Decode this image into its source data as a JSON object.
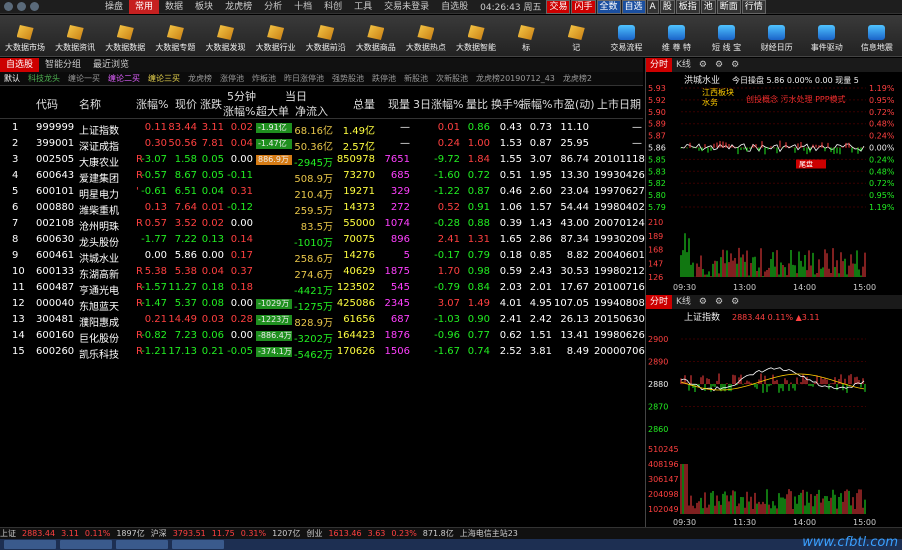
{
  "menubar": {
    "items": [
      "操盘",
      "常用",
      "数据",
      "板块",
      "龙虎榜",
      "分析",
      "十档",
      "科创",
      "工具",
      "交易未登录",
      "自选股"
    ],
    "active_index": 1,
    "clock": "04:26:43 周五",
    "buttons": [
      "交易",
      "闪手",
      "全数",
      "自选",
      "A",
      "股",
      "板指",
      "池",
      "断面",
      "行情"
    ]
  },
  "toolbar": {
    "items": [
      "大数据市场",
      "大数据资讯",
      "大数据数据",
      "大数据专题",
      "大数据发现",
      "大数据行业",
      "大数据前沿",
      "大数据商品",
      "大数据热点",
      "大数据智能",
      "标",
      "记",
      "交易流程",
      "维 尊 特",
      "短 线 宝",
      "财经日历",
      "事件驱动",
      "信息地震"
    ]
  },
  "tabs1": [
    "自选股",
    "智能分组",
    "最近浏览"
  ],
  "tabs2": [
    "默认",
    "科技龙头",
    "缠论一买",
    "缠论二买",
    "缠论三买",
    "龙虎榜",
    "涨停池",
    "炸板池",
    "昨日涨停池",
    "强势股池",
    "跌停池",
    "新股池",
    "次新股池",
    "龙虎榜20190712_43",
    "龙虎榜2"
  ],
  "table": {
    "headers": [
      "代码",
      "名称",
      "涨幅%",
      "现价",
      "涨跌",
      "5分钟",
      "涨幅%",
      "超大单",
      "当日",
      "净流入",
      "总量",
      "现量",
      "3日涨幅%",
      "量比",
      "换手%",
      "振幅%",
      "市盈(动)",
      "上市日期"
    ],
    "rows": [
      {
        "idx": "1",
        "code": "999999",
        "name": "上证指数",
        "chg": "0.11",
        "price": "83.44",
        "diff": "3.11",
        "m5": "0.02",
        "big": "-1.91亿",
        "net": "68.16亿",
        "vol": "1.49亿",
        "cur": "—",
        "d3": "0.01",
        "lb": "0.86",
        "hs": "0.43",
        "zf": "0.73",
        "pe": "11.10",
        "date": "—",
        "up": "r",
        "flag": ""
      },
      {
        "idx": "2",
        "code": "399001",
        "name": "深证成指",
        "chg": "0.30",
        "price": "50.56",
        "diff": "7.81",
        "m5": "0.04",
        "big": "-1.47亿",
        "net": "50.36亿",
        "vol": "2.57亿",
        "cur": "—",
        "d3": "0.24",
        "lb": "1.00",
        "hs": "1.53",
        "zf": "0.87",
        "pe": "25.95",
        "date": "—",
        "up": "r",
        "flag": ""
      },
      {
        "idx": "3",
        "code": "002505",
        "name": "大康农业",
        "chg": "-3.07",
        "price": "1.58",
        "diff": "0.05",
        "m5": "0.00",
        "big": "886.9万",
        "net": "-2945万",
        "vol": "850978",
        "cur": "7651",
        "d3": "-9.72",
        "lb": "1.84",
        "hs": "1.55",
        "zf": "3.07",
        "pe": "86.74",
        "date": "20101118",
        "up": "g",
        "flag": "R"
      },
      {
        "idx": "4",
        "code": "600643",
        "name": "爱建集团",
        "chg": "-0.57",
        "price": "8.67",
        "diff": "0.05",
        "m5": "-0.11",
        "big": "",
        "net": "508.9万",
        "vol": "73270",
        "cur": "685",
        "d3": "-1.60",
        "lb": "0.72",
        "hs": "0.51",
        "zf": "1.95",
        "pe": "13.30",
        "date": "19930426",
        "up": "g",
        "flag": "R"
      },
      {
        "idx": "5",
        "code": "600101",
        "name": "明星电力",
        "chg": "-0.61",
        "price": "6.51",
        "diff": "0.04",
        "m5": "0.31",
        "big": "",
        "net": "210.4万",
        "vol": "19271",
        "cur": "329",
        "d3": "-1.22",
        "lb": "0.87",
        "hs": "0.46",
        "zf": "2.60",
        "pe": "23.04",
        "date": "19970627",
        "up": "g",
        "flag": "'"
      },
      {
        "idx": "6",
        "code": "000880",
        "name": "潍柴重机",
        "chg": "0.13",
        "price": "7.64",
        "diff": "0.01",
        "m5": "-0.12",
        "big": "",
        "net": "259.5万",
        "vol": "14373",
        "cur": "272",
        "d3": "0.52",
        "lb": "0.91",
        "hs": "1.06",
        "zf": "1.57",
        "pe": "54.44",
        "date": "19980402",
        "up": "r",
        "flag": ""
      },
      {
        "idx": "7",
        "code": "002108",
        "name": "沧州明珠",
        "chg": "0.57",
        "price": "3.52",
        "diff": "0.02",
        "m5": "0.00",
        "big": "",
        "net": "83.5万",
        "vol": "55000",
        "cur": "1074",
        "d3": "-0.28",
        "lb": "0.88",
        "hs": "0.39",
        "zf": "1.43",
        "pe": "43.00",
        "date": "20070124",
        "up": "r",
        "flag": "R"
      },
      {
        "idx": "8",
        "code": "600630",
        "name": "龙头股份",
        "chg": "-1.77",
        "price": "7.22",
        "diff": "0.13",
        "m5": "0.14",
        "big": "",
        "net": "-1010万",
        "vol": "70075",
        "cur": "896",
        "d3": "2.41",
        "lb": "1.31",
        "hs": "1.65",
        "zf": "2.86",
        "pe": "87.34",
        "date": "19930209",
        "up": "g",
        "flag": ""
      },
      {
        "idx": "9",
        "code": "600461",
        "name": "洪城水业",
        "chg": "0.00",
        "price": "5.86",
        "diff": "0.00",
        "m5": "0.17",
        "big": "",
        "net": "258.6万",
        "vol": "14276",
        "cur": "5",
        "d3": "-0.17",
        "lb": "0.79",
        "hs": "0.18",
        "zf": "0.85",
        "pe": "8.82",
        "date": "20040601",
        "up": "w",
        "flag": ""
      },
      {
        "idx": "10",
        "code": "600133",
        "name": "东湖高新",
        "chg": "5.38",
        "price": "5.38",
        "diff": "0.04",
        "m5": "0.37",
        "big": "",
        "net": "274.6万",
        "vol": "40629",
        "cur": "1875",
        "d3": "1.70",
        "lb": "0.98",
        "hs": "0.59",
        "zf": "2.43",
        "pe": "30.53",
        "date": "19980212",
        "up": "r",
        "flag": "R"
      },
      {
        "idx": "11",
        "code": "600487",
        "name": "亨通光电",
        "chg": "-1.57",
        "price": "11.27",
        "diff": "0.18",
        "m5": "0.18",
        "big": "",
        "net": "-4421万",
        "vol": "123502",
        "cur": "545",
        "d3": "-0.79",
        "lb": "0.84",
        "hs": "2.03",
        "zf": "2.01",
        "pe": "17.67",
        "date": "20100716",
        "up": "g",
        "flag": "R"
      },
      {
        "idx": "12",
        "code": "000040",
        "name": "东旭蓝天",
        "chg": "-1.47",
        "price": "5.37",
        "diff": "0.08",
        "m5": "0.00",
        "big": "-1029万",
        "net": "-1275万",
        "vol": "425086",
        "cur": "2345",
        "d3": "3.07",
        "lb": "1.49",
        "hs": "4.01",
        "zf": "4.95",
        "pe": "107.05",
        "date": "19940808",
        "up": "g",
        "flag": "R"
      },
      {
        "idx": "13",
        "code": "300481",
        "name": "濮阳惠成",
        "chg": "0.21",
        "price": "14.49",
        "diff": "0.03",
        "m5": "0.28",
        "big": "-1223万",
        "net": "828.9万",
        "vol": "61656",
        "cur": "687",
        "d3": "-1.03",
        "lb": "0.90",
        "hs": "2.41",
        "zf": "2.42",
        "pe": "26.13",
        "date": "20150630",
        "up": "r",
        "flag": ""
      },
      {
        "idx": "14",
        "code": "600160",
        "name": "巨化股份",
        "chg": "-0.82",
        "price": "7.23",
        "diff": "0.06",
        "m5": "0.00",
        "big": "-886.4万",
        "net": "-3202万",
        "vol": "164423",
        "cur": "1876",
        "d3": "-0.96",
        "lb": "0.77",
        "hs": "0.62",
        "zf": "1.51",
        "pe": "13.41",
        "date": "19980626",
        "up": "g",
        "flag": "R"
      },
      {
        "idx": "15",
        "code": "600260",
        "name": "凯乐科技",
        "chg": "-1.21",
        "price": "17.13",
        "diff": "0.21",
        "m5": "-0.05",
        "big": "-374.1万",
        "net": "-5462万",
        "vol": "170626",
        "cur": "1506",
        "d3": "-1.67",
        "lb": "0.74",
        "hs": "2.52",
        "zf": "3.81",
        "pe": "8.49",
        "date": "20000706",
        "up": "g",
        "flag": "R"
      }
    ]
  },
  "panel_top": {
    "tabs": [
      "分时",
      "K线"
    ],
    "stock": "洪城水业",
    "quote": "今日操盘 5.86 0.00% 0.00 现量 5",
    "label1": "江西板块",
    "label2": "水务",
    "concepts": "创投概念 污水处理 PPP模式",
    "y_right": [
      "1.19%",
      "0.95%",
      "0.72%",
      "0.48%",
      "0.24%",
      "0.00%",
      "0.24%",
      "0.48%",
      "0.72%",
      "0.95%",
      "1.19%"
    ],
    "y_left": [
      "5.93",
      "5.92",
      "5.90",
      "5.89",
      "5.87",
      "5.86",
      "5.85",
      "5.83",
      "5.82",
      "5.80",
      "5.79"
    ],
    "vol_left": [
      "210",
      "189",
      "168",
      "147",
      "126"
    ],
    "x_labels": [
      "09:30",
      "13:00",
      "14:00",
      "15:00"
    ],
    "marker": "尾盘"
  },
  "panel_bottom": {
    "tabs": [
      "分时",
      "K线"
    ],
    "index": "上证指数",
    "quote": "2883.44 0.11% ▲3.11",
    "y_left": [
      "2900",
      "2890",
      "2880",
      "2870",
      "2860"
    ],
    "vol_left": [
      "510245",
      "408196",
      "306147",
      "204098",
      "102049"
    ],
    "x_labels": [
      "09:30",
      "11:30",
      "14:00",
      "15:00"
    ]
  },
  "statusbar": {
    "segments": [
      "上证",
      "2883.44",
      "3.11",
      "0.11%",
      "1897亿",
      "沪深",
      "3793.51",
      "11.75",
      "0.31%",
      "1207亿",
      "创业",
      "1613.46",
      "3.63",
      "0.23%",
      "871.8亿",
      "上海电信主站23"
    ]
  },
  "watermark": "www.cfbtl.com",
  "colors": {
    "up": "#ff4040",
    "down": "#22ee22",
    "flat": "#ffffff",
    "accent": "#c62020"
  }
}
